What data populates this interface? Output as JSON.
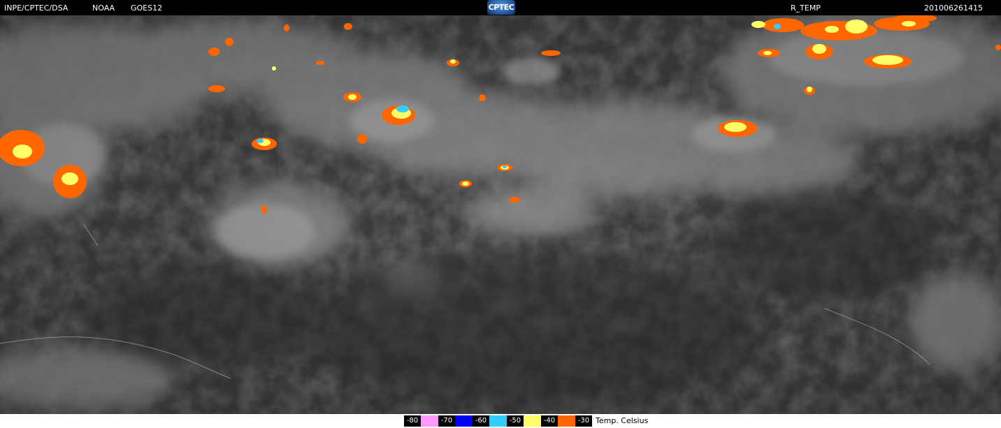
{
  "header": {
    "agency": "INPE/CPTEC/DSA",
    "provider": "NOAA",
    "satellite": "GOES12",
    "logo_text": "CPTEC",
    "product": "R_TEMP",
    "timestamp": "201006261415"
  },
  "legend": {
    "unit": "Temp. Celsius",
    "scale": [
      {
        "label": "-80",
        "color": "#ff99ff"
      },
      {
        "label": "-70",
        "color": "#0000ff"
      },
      {
        "label": "-60",
        "color": "#33ccff"
      },
      {
        "label": "-50",
        "color": "#ffff66"
      },
      {
        "label": "-40",
        "color": "#ff6600"
      },
      {
        "label": "-30",
        "color": ""
      }
    ]
  },
  "colors": {
    "background_dark": "#3c3c3c",
    "cloud_gray": "#9a9a9a",
    "cold_orange": "#ff6600",
    "colder_yellow": "#ffff66",
    "coldest_cyan": "#33ccff"
  }
}
